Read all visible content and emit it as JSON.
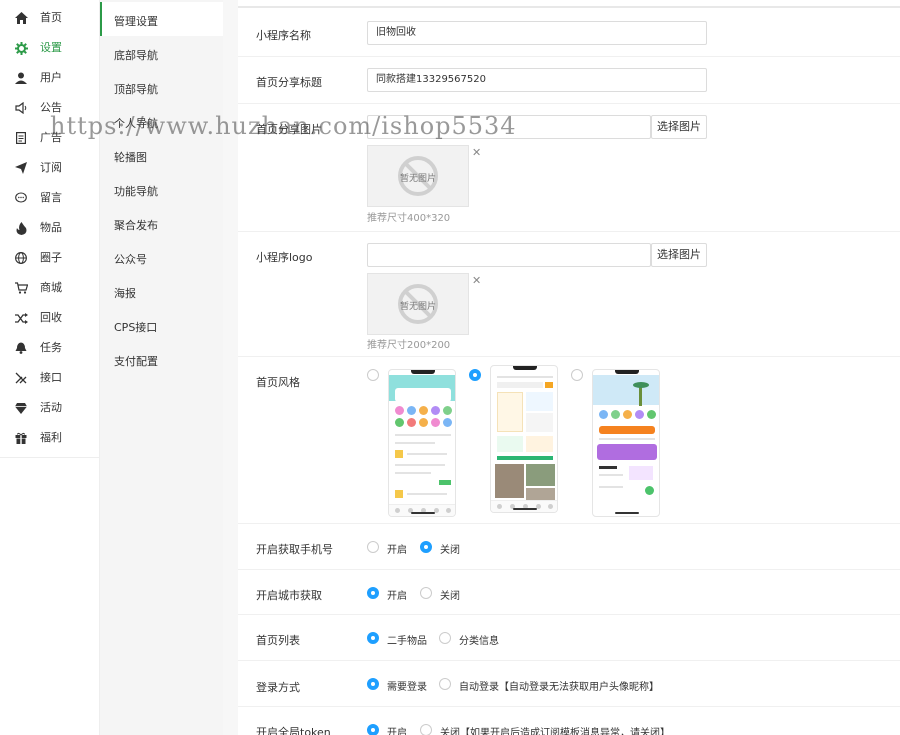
{
  "nav": {
    "items": [
      {
        "label": "首页",
        "icon": "home-icon"
      },
      {
        "label": "设置",
        "icon": "gear-icon"
      },
      {
        "label": "用户",
        "icon": "user-icon"
      },
      {
        "label": "公告",
        "icon": "speaker-icon"
      },
      {
        "label": "广告",
        "icon": "document-icon"
      },
      {
        "label": "订阅",
        "icon": "paper-plane-icon"
      },
      {
        "label": "留言",
        "icon": "chat-bubble-icon"
      },
      {
        "label": "物品",
        "icon": "flame-icon"
      },
      {
        "label": "圈子",
        "icon": "globe-icon"
      },
      {
        "label": "商城",
        "icon": "cart-icon"
      },
      {
        "label": "回收",
        "icon": "shuffle-icon"
      },
      {
        "label": "任务",
        "icon": "bell-icon"
      },
      {
        "label": "接口",
        "icon": "tools-icon"
      },
      {
        "label": "活动",
        "icon": "diamond-icon"
      },
      {
        "label": "福利",
        "icon": "gift-icon"
      }
    ],
    "active_index": 1,
    "active_color": "#2b9a47"
  },
  "subnav": {
    "items": [
      "管理设置",
      "底部导航",
      "顶部导航",
      "个人导航",
      "轮播图",
      "功能导航",
      "聚合发布",
      "公众号",
      "海报",
      "CPS接口",
      "支付配置"
    ],
    "active_index": 0
  },
  "form": {
    "app_name": {
      "label": "小程序名称",
      "value": "旧物回收"
    },
    "share_title": {
      "label": "首页分享标题",
      "value": "同款搭建13329567520"
    },
    "share_image": {
      "label": "首页分享图片",
      "value": "",
      "button": "选择图片",
      "placeholder_text": "暂无图片",
      "hint": "推荐尺寸400*320"
    },
    "logo": {
      "label": "小程序logo",
      "value": "",
      "button": "选择图片",
      "placeholder_text": "暂无图片",
      "hint": "推荐尺寸200*200"
    },
    "style": {
      "label": "首页风格",
      "selected_index": 1,
      "options_count": 3
    },
    "phone_auth": {
      "label": "开启获取手机号",
      "options": [
        "开启",
        "关闭"
      ],
      "selected_index": 1
    },
    "city": {
      "label": "开启城市获取",
      "options": [
        "开启",
        "关闭"
      ],
      "selected_index": 0
    },
    "list": {
      "label": "首页列表",
      "options": [
        "二手物品",
        "分类信息"
      ],
      "selected_index": 0
    },
    "login": {
      "label": "登录方式",
      "options": [
        "需要登录",
        "自动登录【自动登录无法获取用户头像昵称】"
      ],
      "selected_index": 0
    },
    "token": {
      "label": "开启全局token",
      "options": [
        "开启",
        "关闭【如果开启后造成订阅模板消息异常，请关闭】"
      ],
      "selected_index": 0
    }
  },
  "radio_color": "#1e9fff",
  "watermark": "https://www.huzhan.com/ishop5534"
}
